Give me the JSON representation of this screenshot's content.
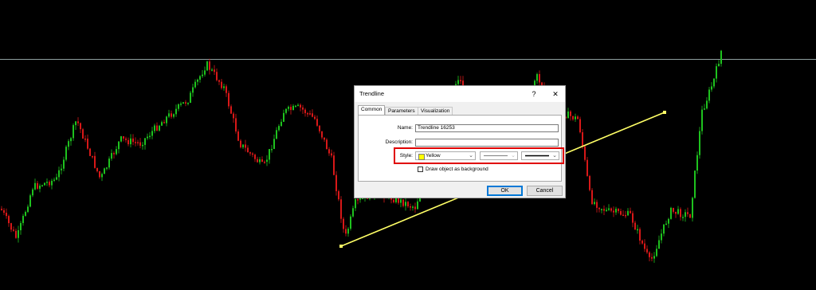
{
  "colors": {
    "background": "#000000",
    "bull": "#1ec21e",
    "bear": "#d81818",
    "trendline": "#ffff66",
    "level": "#8fa0a0",
    "highlight": "#e00000"
  },
  "dialog": {
    "title": "Trendline",
    "help_glyph": "?",
    "close_glyph": "✕",
    "tabs": [
      "Common",
      "Parameters",
      "Visualization"
    ],
    "active_tab": "Common",
    "name_label": "Name:",
    "name_value": "Trendline 16253",
    "description_label": "Description:",
    "description_value": "",
    "style_label": "Style:",
    "color_value": "Yellow",
    "checkbox_label": "Draw object as background",
    "checkbox_checked": false,
    "ok_label": "OK",
    "cancel_label": "Cancel"
  },
  "chart": {
    "icons": [
      "trendline-anchor-icon"
    ]
  }
}
